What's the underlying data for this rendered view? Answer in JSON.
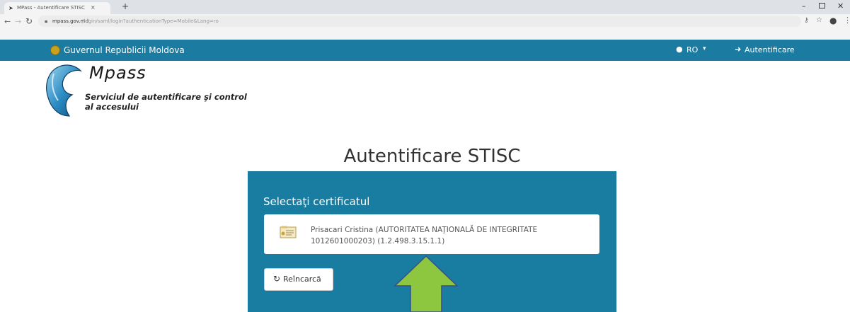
{
  "browser": {
    "tab_title": "MPass - Autentificare STISC",
    "tab_favicon": "mpass-favicon",
    "new_tab_label": "+",
    "url_domain": "mpass.gov.md",
    "url_path": "/login/saml/login?authenticationType=Mobile&Lang=ro",
    "icons": [
      "back-icon",
      "forward-icon",
      "reload-icon",
      "lock-icon",
      "key-icon",
      "star-icon",
      "account-icon",
      "menu-icon"
    ]
  },
  "navbar": {
    "gov_name": "Guvernul Republicii Moldova",
    "language": "RO",
    "login_label": "Autentificare",
    "background": "#1c7ba0"
  },
  "logo": {
    "brand": "Mpass",
    "tagline": "Serviciul de autentificare şi control al accesului"
  },
  "main": {
    "title": "Autentificare STISC",
    "panel_heading": "Selectaţi certificatul",
    "certificate": {
      "label": "Prisacari Cristina (AUTORITATEA NAŢIONALĂ DE INTEGRITATE 1012601000203) (1.2.498.3.15.1.1)"
    },
    "reload_label": "Reîncarcă",
    "panel_color": "#197da2"
  },
  "annotation": {
    "arrow_color": "#8dc63f",
    "arrow_outline": "#3a4f8a",
    "arrow_direction": "up"
  }
}
